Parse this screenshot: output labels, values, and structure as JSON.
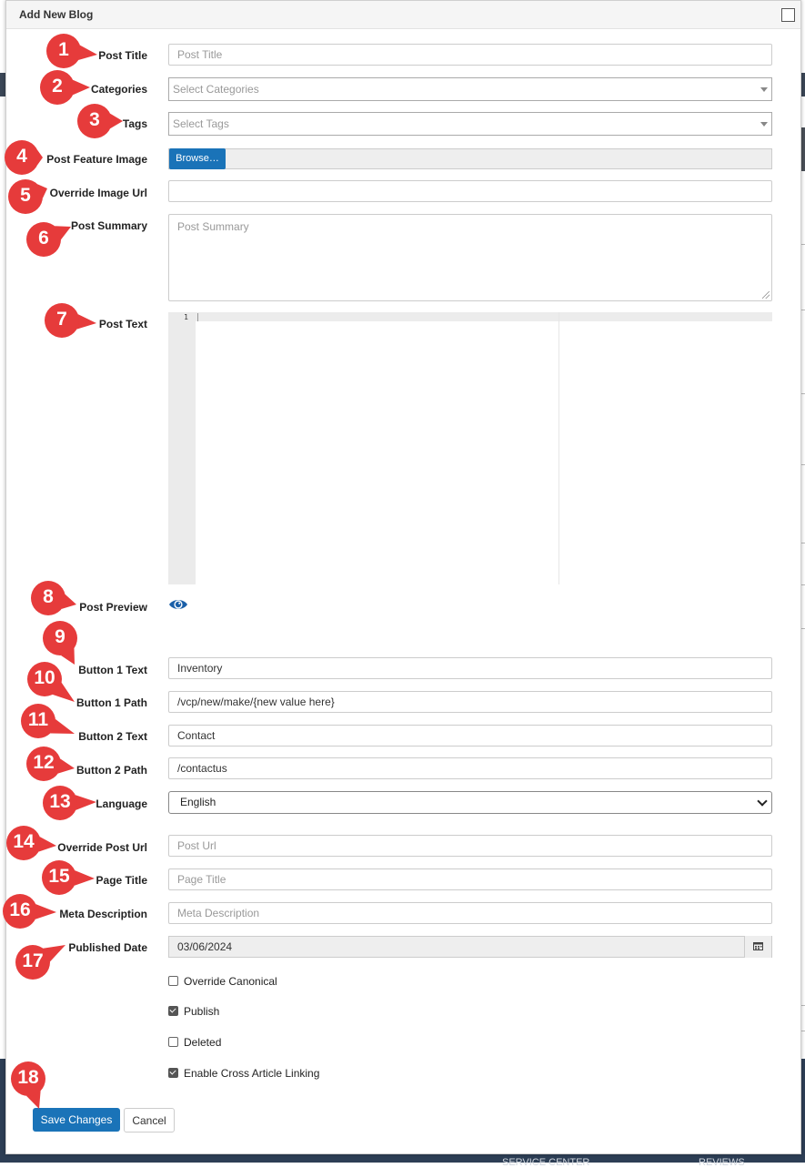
{
  "modal": {
    "title": "Add New Blog"
  },
  "fields": {
    "post_title": {
      "label": "Post Title",
      "placeholder": "Post Title"
    },
    "categories": {
      "label": "Categories",
      "placeholder": "Select Categories"
    },
    "tags": {
      "label": "Tags",
      "placeholder": "Select Tags"
    },
    "feature_image": {
      "label": "Post Feature Image",
      "button": "Browse…"
    },
    "override_image_url": {
      "label": "Override Image Url",
      "value": ""
    },
    "post_summary": {
      "label": "Post Summary",
      "placeholder": "Post Summary"
    },
    "post_text": {
      "label": "Post Text",
      "line_number": "1"
    },
    "post_preview": {
      "label": "Post Preview",
      "icon": "eye-icon"
    },
    "button1_text": {
      "label": "Button 1 Text",
      "value": "Inventory"
    },
    "button1_path": {
      "label": "Button 1 Path",
      "value": "/vcp/new/make/{new value here}"
    },
    "button2_text": {
      "label": "Button 2 Text",
      "value": "Contact"
    },
    "button2_path": {
      "label": "Button 2 Path",
      "value": "/contactus"
    },
    "language": {
      "label": "Language",
      "value": "English"
    },
    "override_post_url": {
      "label": "Override Post Url",
      "placeholder": "Post Url"
    },
    "page_title": {
      "label": "Page Title",
      "placeholder": "Page Title"
    },
    "meta_description": {
      "label": "Meta Description",
      "placeholder": "Meta Description"
    },
    "published_date": {
      "label": "Published Date",
      "value": "03/06/2024"
    }
  },
  "checkboxes": [
    {
      "label": "Override Canonical",
      "checked": false
    },
    {
      "label": "Publish",
      "checked": true
    },
    {
      "label": "Deleted",
      "checked": false
    },
    {
      "label": "Enable Cross Article Linking",
      "checked": true
    }
  ],
  "actions": {
    "save": "Save Changes",
    "cancel": "Cancel"
  },
  "markers": [
    "1",
    "2",
    "3",
    "4",
    "5",
    "6",
    "7",
    "8",
    "9",
    "10",
    "11",
    "12",
    "13",
    "14",
    "15",
    "16",
    "17",
    "18"
  ],
  "background": {
    "footer_left": "SERVICE CENTER",
    "footer_right": "REVIEWS"
  },
  "colors": {
    "primary": "#1a73b8",
    "marker": "#e63b3b"
  }
}
